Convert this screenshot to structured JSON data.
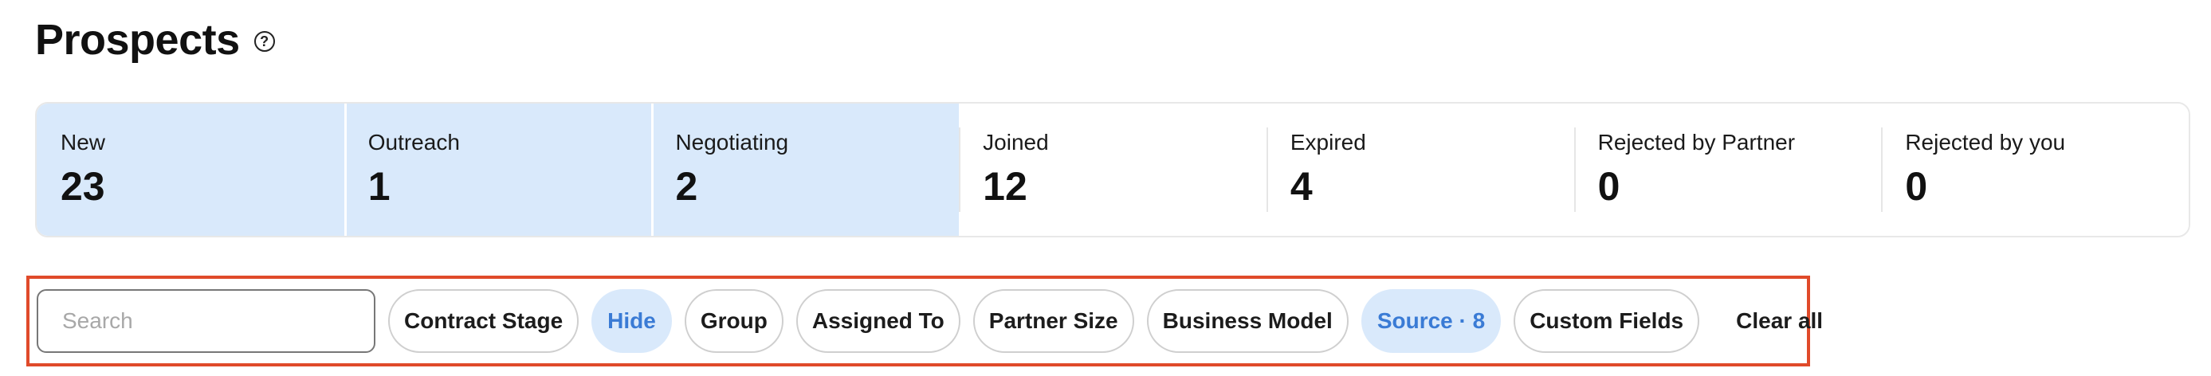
{
  "header": {
    "title": "Prospects",
    "help_glyph": "?"
  },
  "stages": [
    {
      "label": "New",
      "count": "23",
      "active": true
    },
    {
      "label": "Outreach",
      "count": "1",
      "active": true
    },
    {
      "label": "Negotiating",
      "count": "2",
      "active": true
    },
    {
      "label": "Joined",
      "count": "12",
      "active": false
    },
    {
      "label": "Expired",
      "count": "4",
      "active": false
    },
    {
      "label": "Rejected by Partner",
      "count": "0",
      "active": false
    },
    {
      "label": "Rejected by you",
      "count": "0",
      "active": false
    }
  ],
  "filters": {
    "search_placeholder": "Search",
    "search_value": "",
    "chips": [
      {
        "label": "Contract Stage",
        "selected": false
      },
      {
        "label": "Hide",
        "selected": true
      },
      {
        "label": "Group",
        "selected": false
      },
      {
        "label": "Assigned To",
        "selected": false
      },
      {
        "label": "Partner Size",
        "selected": false
      },
      {
        "label": "Business Model",
        "selected": false
      },
      {
        "label": "Source · 8",
        "selected": true
      },
      {
        "label": "Custom Fields",
        "selected": false
      }
    ],
    "clear_all_label": "Clear all"
  },
  "colors": {
    "active_background": "#d9e9fb",
    "selected_text": "#3a7bd5",
    "highlight_border": "#e04a2a"
  }
}
